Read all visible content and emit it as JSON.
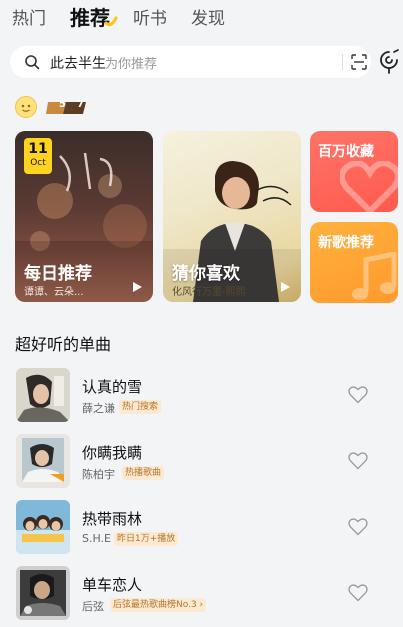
{
  "tabs": [
    {
      "label": "热门"
    },
    {
      "label": "推荐"
    },
    {
      "label": "听书"
    },
    {
      "label": "发现"
    }
  ],
  "search": {
    "query": "此去半生",
    "hint": "为你推荐"
  },
  "badge": {
    "level_left": "5",
    "level_right": "7"
  },
  "cards": {
    "daily": {
      "title": "每日推荐",
      "subtitle": "谭谭、云朵...",
      "date_day": "11",
      "date_month": "Oct"
    },
    "guess": {
      "title": "猜你喜欢",
      "subtitle": "化风行万里-熙熙"
    },
    "favorites": {
      "title": "百万收藏"
    },
    "new_songs": {
      "title": "新歌推荐"
    }
  },
  "section": {
    "title": "超好听的单曲"
  },
  "songs": [
    {
      "title": "认真的雪",
      "artist": "薛之谦",
      "tag": "热门搜索"
    },
    {
      "title": "你瞒我瞒",
      "artist": "陈柏宇",
      "tag": "热播歌曲"
    },
    {
      "title": "热带雨林",
      "artist": "S.H.E",
      "tag": "昨日1万+播放"
    },
    {
      "title": "单车恋人",
      "artist": "后弦",
      "tag": "后弦最热歌曲榜No.3 ›"
    }
  ],
  "colors": {
    "accent_yellow": "#ffd41f",
    "favorites_red": "#ff6357",
    "new_orange": "#ffa635",
    "tag_bg": "#fbe9d2",
    "tag_text": "#b5762a"
  }
}
